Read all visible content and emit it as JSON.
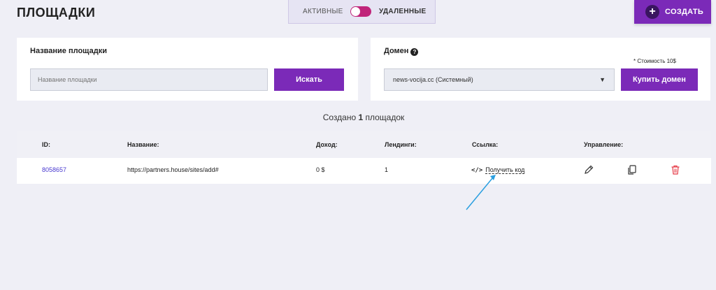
{
  "header": {
    "title": "ПЛОЩАДКИ",
    "toggle_active": "АКТИВНЫЕ",
    "toggle_deleted": "УДАЛЕННЫЕ",
    "create_label": "СОЗДАТЬ"
  },
  "search_panel": {
    "label": "Название площадки",
    "placeholder": "Название площадки",
    "button": "Искать"
  },
  "domain_panel": {
    "label": "Домен",
    "cost_note": "* Стоимость 10$",
    "selected": "news-vocija.cc (Системный)",
    "button": "Купить домен"
  },
  "summary": {
    "prefix": "Создано",
    "count": "1",
    "suffix": "площадок"
  },
  "table": {
    "headers": [
      "ID:",
      "Название:",
      "Доход:",
      "Лендинги:",
      "Ссылка:",
      "Управление:"
    ],
    "rows": [
      {
        "id": "8058657",
        "name": "https://partners.house/sites/add#",
        "income": "0 $",
        "landings": "1",
        "link": "Получить код"
      }
    ]
  },
  "colors": {
    "accent": "#7b2ab8",
    "toggle": "#c0247a",
    "delete": "#e53945",
    "link": "#4a3ad0",
    "annotation_arrow": "#2a9fe0"
  },
  "icons": [
    "plus-icon",
    "help-icon",
    "chevron-down-icon",
    "code-icon",
    "edit-icon",
    "copy-icon",
    "trash-icon",
    "arrow-annotation"
  ]
}
